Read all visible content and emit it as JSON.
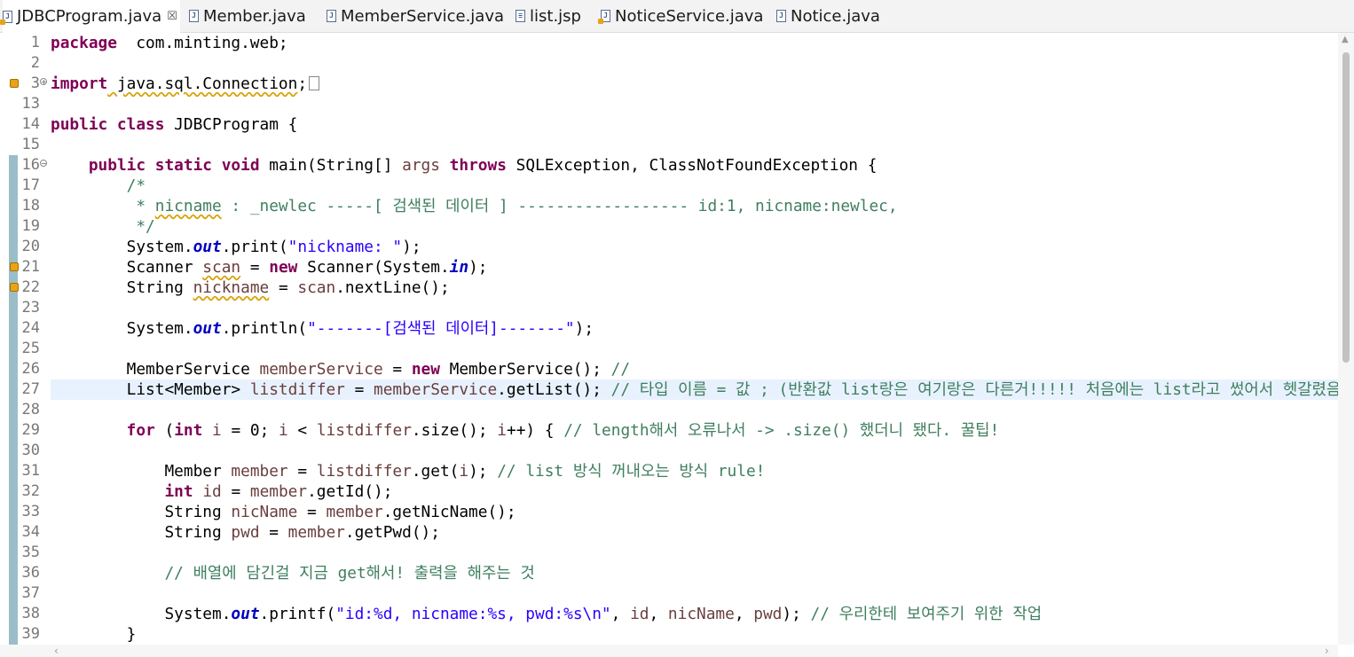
{
  "tabs": [
    {
      "label": "JDBCProgram.java",
      "active": true,
      "icon": "java-file-warning-icon",
      "closable": true
    },
    {
      "label": "Member.java",
      "active": false,
      "icon": "java-file-icon"
    },
    {
      "label": "MemberService.java",
      "active": false,
      "icon": "java-file-icon"
    },
    {
      "label": "list.jsp",
      "active": false,
      "icon": "jsp-file-icon"
    },
    {
      "label": "NoticeService.java",
      "active": false,
      "icon": "java-file-warning-icon"
    },
    {
      "label": "Notice.java",
      "active": false,
      "icon": "java-file-icon"
    }
  ],
  "tab_close_glyph": "☒",
  "editor": {
    "current_line": 27,
    "lines": [
      {
        "n": "1",
        "segs": [
          [
            "kw",
            "package"
          ],
          [
            "",
            "  com.minting.web;"
          ]
        ]
      },
      {
        "n": "2",
        "segs": []
      },
      {
        "n": "3",
        "segs": [
          [
            "kw",
            "import"
          ],
          [
            "sq",
            " java.sql.Connection"
          ],
          [
            "",
            ";"
          ]
        ]
      },
      {
        "n": "13",
        "segs": []
      },
      {
        "n": "14",
        "segs": [
          [
            "kw",
            "public class"
          ],
          [
            "",
            " JDBCProgram {"
          ]
        ]
      },
      {
        "n": "15",
        "segs": []
      },
      {
        "n": "16",
        "segs": [
          [
            "",
            "    "
          ],
          [
            "kw",
            "public static void"
          ],
          [
            "",
            " main(String[] "
          ],
          [
            "var",
            "args"
          ],
          [
            "",
            " "
          ],
          [
            "kw",
            "throws"
          ],
          [
            "",
            " SQLException, ClassNotFoundException {"
          ]
        ]
      },
      {
        "n": "17",
        "segs": [
          [
            "cmt",
            "        /*"
          ]
        ]
      },
      {
        "n": "18",
        "segs": [
          [
            "cmt",
            "         * "
          ],
          [
            "cmt sq",
            "nicname"
          ],
          [
            "cmt",
            " : _newlec -----[ 검색된 데이터 ] ------------------ id:1, nicname:newlec,"
          ]
        ]
      },
      {
        "n": "19",
        "segs": [
          [
            "cmt",
            "         */"
          ]
        ]
      },
      {
        "n": "20",
        "segs": [
          [
            "",
            "        System."
          ],
          [
            "fld",
            "out"
          ],
          [
            "",
            ".print("
          ],
          [
            "str",
            "\"nickname: \""
          ],
          [
            "",
            ");"
          ]
        ]
      },
      {
        "n": "21",
        "segs": [
          [
            "",
            "        Scanner "
          ],
          [
            "var sq",
            "scan"
          ],
          [
            "",
            " = "
          ],
          [
            "kw",
            "new"
          ],
          [
            "",
            " Scanner(System."
          ],
          [
            "fld",
            "in"
          ],
          [
            "",
            ");"
          ]
        ]
      },
      {
        "n": "22",
        "segs": [
          [
            "",
            "        String "
          ],
          [
            "var sq",
            "nickname"
          ],
          [
            "",
            " = "
          ],
          [
            "var",
            "scan"
          ],
          [
            "",
            ".nextLine();"
          ]
        ]
      },
      {
        "n": "23",
        "segs": []
      },
      {
        "n": "24",
        "segs": [
          [
            "",
            "        System."
          ],
          [
            "fld",
            "out"
          ],
          [
            "",
            ".println("
          ],
          [
            "str",
            "\"-------[검색된 데이터]-------\""
          ],
          [
            "",
            ");"
          ]
        ]
      },
      {
        "n": "25",
        "segs": []
      },
      {
        "n": "26",
        "segs": [
          [
            "",
            "        MemberService "
          ],
          [
            "var",
            "memberService"
          ],
          [
            "",
            " = "
          ],
          [
            "kw",
            "new"
          ],
          [
            "",
            " MemberService(); "
          ],
          [
            "cmt",
            "//"
          ]
        ]
      },
      {
        "n": "27",
        "segs": [
          [
            "",
            "        List<Member> "
          ],
          [
            "var",
            "listdiffer"
          ],
          [
            "",
            " = "
          ],
          [
            "var",
            "memberService"
          ],
          [
            "",
            ".getList(); "
          ],
          [
            "cmt",
            "// 타입 이름 = 값 ; (반환값 list랑은 여기랑은 다른거!!!!! 처음에는 list라고 썼어서 헷갈렸음)"
          ]
        ]
      },
      {
        "n": "28",
        "segs": []
      },
      {
        "n": "29",
        "segs": [
          [
            "",
            "        "
          ],
          [
            "kw",
            "for"
          ],
          [
            "",
            " ("
          ],
          [
            "kw",
            "int"
          ],
          [
            "",
            " "
          ],
          [
            "var",
            "i"
          ],
          [
            "",
            " = 0; "
          ],
          [
            "var",
            "i"
          ],
          [
            "",
            " < "
          ],
          [
            "var",
            "listdiffer"
          ],
          [
            "",
            ".size(); "
          ],
          [
            "var",
            "i"
          ],
          [
            "",
            "++) { "
          ],
          [
            "cmt",
            "// length해서 오류나서 -> .size() 했더니 됐다. 꿀팁!"
          ]
        ]
      },
      {
        "n": "30",
        "segs": []
      },
      {
        "n": "31",
        "segs": [
          [
            "",
            "            Member "
          ],
          [
            "var",
            "member"
          ],
          [
            "",
            " = "
          ],
          [
            "var",
            "listdiffer"
          ],
          [
            "",
            ".get("
          ],
          [
            "var",
            "i"
          ],
          [
            "",
            "); "
          ],
          [
            "cmt",
            "// list 방식 꺼내오는 방식 rule!"
          ]
        ]
      },
      {
        "n": "32",
        "segs": [
          [
            "",
            "            "
          ],
          [
            "kw",
            "int"
          ],
          [
            "",
            " "
          ],
          [
            "var",
            "id"
          ],
          [
            "",
            " = "
          ],
          [
            "var",
            "member"
          ],
          [
            "",
            ".getId();"
          ]
        ]
      },
      {
        "n": "33",
        "segs": [
          [
            "",
            "            String "
          ],
          [
            "var",
            "nicName"
          ],
          [
            "",
            " = "
          ],
          [
            "var",
            "member"
          ],
          [
            "",
            ".getNicName();"
          ]
        ]
      },
      {
        "n": "34",
        "segs": [
          [
            "",
            "            String "
          ],
          [
            "var",
            "pwd"
          ],
          [
            "",
            " = "
          ],
          [
            "var",
            "member"
          ],
          [
            "",
            ".getPwd();"
          ]
        ]
      },
      {
        "n": "35",
        "segs": []
      },
      {
        "n": "36",
        "segs": [
          [
            "cmt",
            "            // 배열에 담긴걸 지금 get해서! 출력을 해주는 것"
          ]
        ]
      },
      {
        "n": "37",
        "segs": []
      },
      {
        "n": "38",
        "segs": [
          [
            "",
            "            System."
          ],
          [
            "fld",
            "out"
          ],
          [
            "",
            ".printf("
          ],
          [
            "str",
            "\"id:%d, nicname:%s, pwd:%s\\n\""
          ],
          [
            "",
            ", "
          ],
          [
            "var",
            "id"
          ],
          [
            "",
            ", "
          ],
          [
            "var",
            "nicName"
          ],
          [
            "",
            ", "
          ],
          [
            "var",
            "pwd"
          ],
          [
            "",
            "); "
          ],
          [
            "cmt",
            "// 우리한테 보여주기 위한 작업"
          ]
        ]
      },
      {
        "n": "39",
        "segs": [
          [
            "",
            "        }"
          ]
        ]
      }
    ]
  }
}
